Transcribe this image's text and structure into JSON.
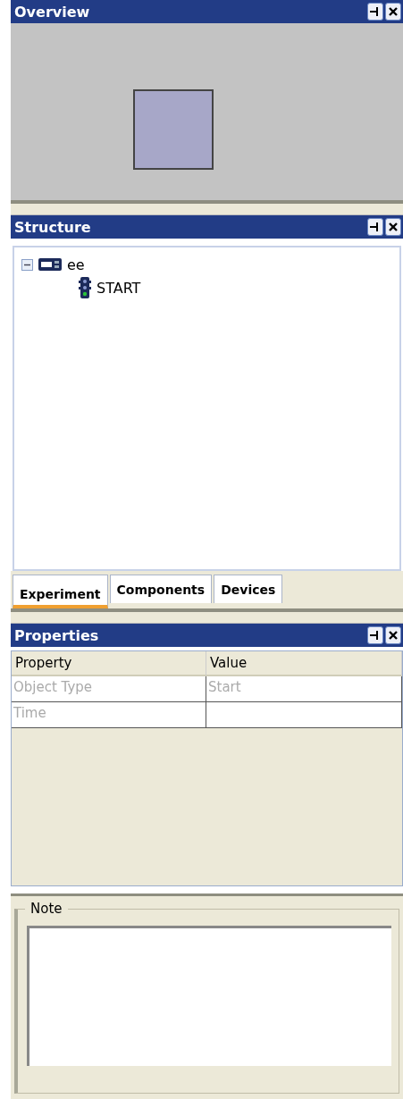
{
  "overview": {
    "title": "Overview"
  },
  "structure": {
    "title": "Structure",
    "tree": [
      {
        "label": "ee",
        "expanded": true,
        "children": [
          {
            "label": "START"
          }
        ]
      }
    ]
  },
  "tabs": [
    {
      "label": "Experiment",
      "selected": true
    },
    {
      "label": "Components",
      "selected": false
    },
    {
      "label": "Devices",
      "selected": false
    }
  ],
  "properties": {
    "title": "Properties",
    "columns": [
      "Property",
      "Value"
    ],
    "rows": [
      {
        "property": "Object Type",
        "value": "Start",
        "disabled": true
      },
      {
        "property": "Time",
        "disabled": true
      }
    ]
  },
  "note": {
    "title": "Note"
  }
}
